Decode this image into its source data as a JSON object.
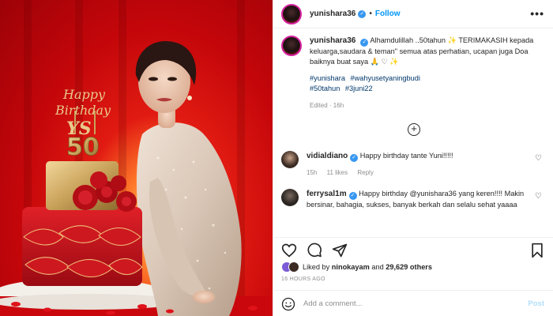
{
  "header": {
    "username": "yunishara36",
    "verified_mark": "✓",
    "separator": "•",
    "follow_label": "Follow",
    "more_label": "•••"
  },
  "photo": {
    "topper_line1": "Happy",
    "topper_line2": "Birthday",
    "topper_initials": "YS",
    "candle_number": "50"
  },
  "caption": {
    "username": "yunishara36",
    "text": "Alhamdulillah ..50tahun ✨ TERIMAKASIH kepada keluarga,saudara & teman\" semua atas perhatian, ucapan juga Doa baiknya buat saya 🙏 ♡ ✨",
    "hashtags": [
      "#yunishara",
      "#wahyusetyaningbudi",
      "#50tahun",
      "#3juni22"
    ],
    "edited": "Edited · 16h"
  },
  "load_more_label": "+",
  "comments": [
    {
      "username": "vidialdiano",
      "text": "Happy birthday tante Yuni!!!!!",
      "time": "15h",
      "likes": "11 likes",
      "reply": "Reply"
    },
    {
      "username": "ferrysal1m",
      "text": "Happy birthday @yunishara36 yang keren!!!! Makin bersinar, bahagia, sukses, banyak berkah dan selalu sehat yaaaa"
    }
  ],
  "likes": {
    "prefix": "Liked by",
    "user": "ninokayam",
    "middle": "and",
    "count": "29,629 others"
  },
  "time_ago": "16 HOURS AGO",
  "add_comment": {
    "placeholder": "Add a comment...",
    "post_label": "Post"
  },
  "colors": {
    "accent": "#0095f6",
    "link": "#00376b",
    "muted": "#8e8e8e",
    "verified": "#3897f0"
  },
  "icons": [
    "heart-icon",
    "comment-icon",
    "share-icon",
    "bookmark-icon",
    "emoji-icon",
    "more-icon",
    "verified-icon"
  ]
}
